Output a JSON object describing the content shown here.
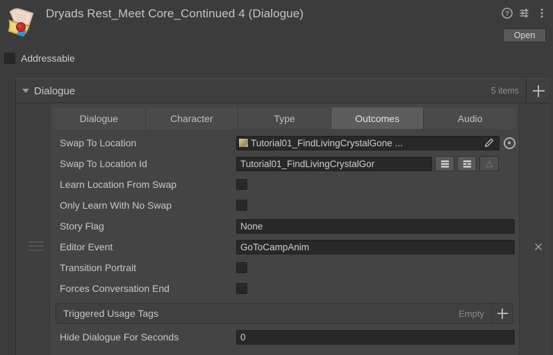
{
  "header": {
    "title": "Dryads Rest_Meet Core_Continued 4 (Dialogue)",
    "asset_icon": "scroll-wax-seal-icon",
    "help_icon": "help-icon",
    "preset_icon": "preset-settings-icon",
    "menu_icon": "kebab-menu-icon",
    "open_label": "Open"
  },
  "addressable": {
    "label": "Addressable",
    "checked": false
  },
  "list": {
    "title": "Dialogue",
    "items_count": "5 items",
    "add_icon": "plus-icon",
    "expanded": true
  },
  "element": {
    "drag_handle_icon": "drag-handle-icon",
    "remove_icon": "close-icon",
    "tabs": [
      {
        "label": "Dialogue",
        "selected": false
      },
      {
        "label": "Character",
        "selected": false
      },
      {
        "label": "Type",
        "selected": false
      },
      {
        "label": "Outcomes",
        "selected": true
      },
      {
        "label": "Audio",
        "selected": false
      }
    ],
    "fields": {
      "swap_to_location": {
        "label": "Swap To Location",
        "value": "Tutorial01_FindLivingCrystalGone ...",
        "thumb_icon": "texture-thumbnail-icon",
        "edit_icon": "pencil-icon",
        "picker_icon": "object-picker-icon"
      },
      "swap_to_location_id": {
        "label": "Swap To Location Id",
        "value": "Tutorial01_FindLivingCrystalGor",
        "button_list_icon": "list-view-icon",
        "button_detail_icon": "detail-view-icon",
        "button_warning_icon": "warning-triangle-icon"
      },
      "learn_location_from_swap": {
        "label": "Learn Location From Swap",
        "checked": false
      },
      "only_learn_with_no_swap": {
        "label": "Only Learn With No Swap",
        "checked": false
      },
      "story_flag": {
        "label": "Story Flag",
        "value": "None"
      },
      "editor_event": {
        "label": "Editor Event",
        "value": "GoToCampAnim"
      },
      "transition_portrait": {
        "label": "Transition Portrait",
        "checked": false
      },
      "forces_conversation_end": {
        "label": "Forces Conversation End",
        "checked": false
      },
      "triggered_usage_tags": {
        "label": "Triggered Usage Tags",
        "empty_label": "Empty",
        "add_icon": "plus-icon"
      },
      "hide_dialogue_for_seconds": {
        "label": "Hide Dialogue For Seconds",
        "value": "0"
      }
    }
  },
  "colors": {
    "window_bg": "#3c3c3c",
    "row_bg": "#444444",
    "field_bg": "#282828",
    "tab_selected": "#5d5d5d",
    "tab_normal": "#4a4a4a",
    "text": "#c6c6c6",
    "text_dim": "#8b8b8b",
    "button_bg": "#585858"
  }
}
